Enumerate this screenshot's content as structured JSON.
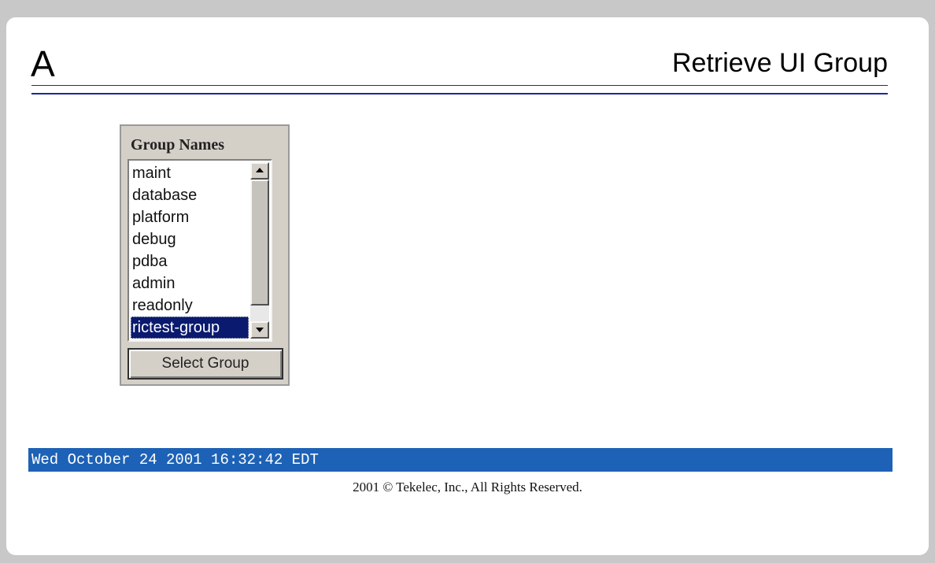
{
  "header": {
    "letter": "A",
    "title": "Retrieve UI Group"
  },
  "group_panel": {
    "heading": "Group Names",
    "items": [
      {
        "label": "maint"
      },
      {
        "label": "database"
      },
      {
        "label": "platform"
      },
      {
        "label": "debug"
      },
      {
        "label": "pdba"
      },
      {
        "label": "admin"
      },
      {
        "label": "readonly"
      },
      {
        "label": "rictest-group"
      }
    ],
    "selected": "rictest-group",
    "button_label": "Select Group"
  },
  "status": {
    "datetime": "Wed October 24 2001 16:32:42 EDT"
  },
  "footer": {
    "copyright": "2001 © Tekelec, Inc., All Rights Reserved."
  },
  "colors": {
    "status_bar": "#1d62b6",
    "selected_item": "#0a1a6e",
    "header_rule": "#1a2a9a",
    "panel": "#d4d0c8"
  }
}
